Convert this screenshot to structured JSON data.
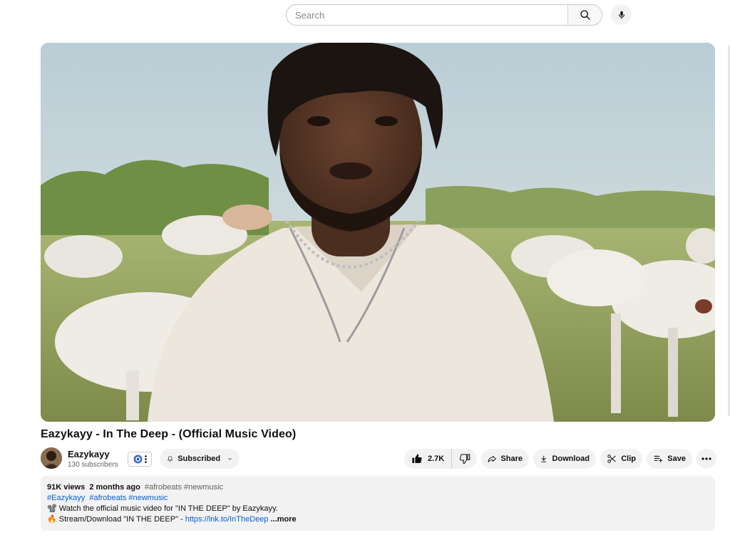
{
  "search": {
    "placeholder": "Search"
  },
  "video": {
    "title": "Eazykayy - In The Deep - (Official Music Video)"
  },
  "channel": {
    "name": "Eazykayy",
    "subscribers": "130 subscribers",
    "subscribe_label": "Subscribed"
  },
  "actions": {
    "likes": "2.7K",
    "share": "Share",
    "download": "Download",
    "clip": "Clip",
    "save": "Save"
  },
  "description": {
    "views": "91K views",
    "age": "2 months ago",
    "meta_tags": "#afrobeats #newmusic",
    "hashtags": [
      "#Eazykayy",
      "#afrobeats",
      "#newmusic"
    ],
    "line1_emoji": "📽️",
    "line1": "Watch the official music video for \"IN THE DEEP\" by Eazykayy.",
    "line2_emoji": "🔥",
    "line2": "Stream/Download \"IN THE DEEP\" - ",
    "link": "https://lnk.to/InTheDeep",
    "more": "...more"
  },
  "colors": {
    "link": "#065fd4",
    "chip_bg": "#f2f2f2"
  }
}
